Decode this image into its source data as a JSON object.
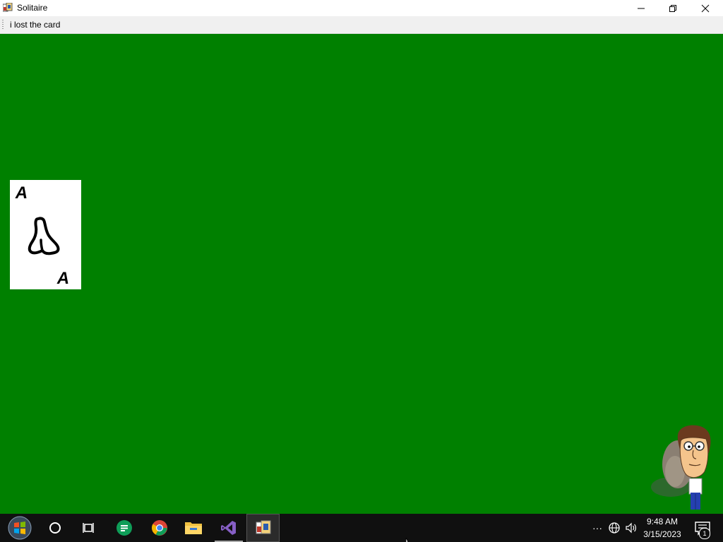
{
  "window": {
    "title": "Solitaire",
    "icon": "solitaire-app-icon",
    "controls": [
      "minimize-icon",
      "restore-icon",
      "close-icon"
    ]
  },
  "menu": {
    "items": [
      {
        "label": "i lost the card"
      }
    ]
  },
  "table": {
    "background_color": "#008000",
    "card": {
      "rank_top": "A",
      "rank_bottom": "A",
      "suit_icon": "hand-drawn-suit-icon"
    },
    "character": "cartoon-character-image"
  },
  "taskbar": {
    "apps": [
      "start-icon",
      "search-icon",
      "task-view-icon",
      "google-sheets-icon",
      "chrome-icon",
      "file-explorer-icon",
      "visual-studio-icon",
      "solitaire-app-icon"
    ],
    "tray": {
      "overflow": "···",
      "time": "9:48 AM",
      "date": "3/15/2023",
      "notification_count": "1"
    }
  }
}
